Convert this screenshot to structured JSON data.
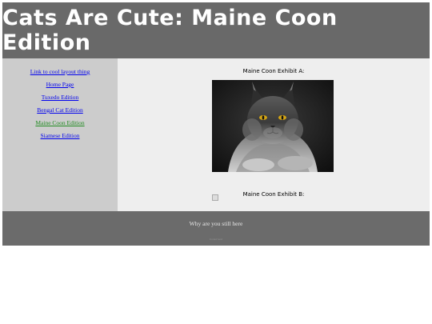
{
  "header": {
    "title": "Cats Are Cute: Maine Coon Edition"
  },
  "sidebar": {
    "links": [
      {
        "label": "Link to cool layout thing"
      },
      {
        "label": "Home Page"
      },
      {
        "label": "Tuxedo Edition"
      },
      {
        "label": "Bengal Cat Edition"
      },
      {
        "label": "Maine Coon Edition",
        "active": true
      },
      {
        "label": "Siamese Edition"
      }
    ]
  },
  "content": {
    "exhibit_a": "Maine Coon Exhibit A:",
    "exhibit_b": "Maine Coon Exhibit B:"
  },
  "footer": {
    "message": "Why are you still here",
    "small_text": "footer text"
  }
}
